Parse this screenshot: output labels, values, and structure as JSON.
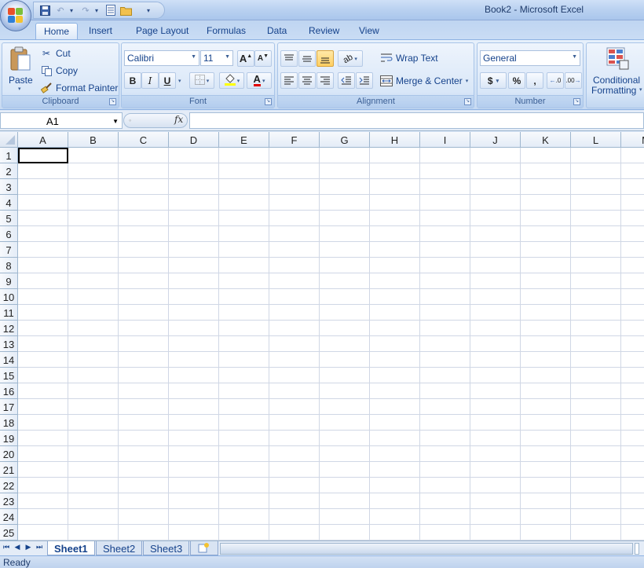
{
  "window": {
    "title": "Book2 - Microsoft Excel"
  },
  "qat": {
    "icons": [
      "save-icon",
      "undo-icon",
      "redo-icon",
      "print-preview-icon",
      "open-icon"
    ]
  },
  "tabs": [
    {
      "label": "Home",
      "active": true
    },
    {
      "label": "Insert"
    },
    {
      "label": "Page Layout"
    },
    {
      "label": "Formulas"
    },
    {
      "label": "Data"
    },
    {
      "label": "Review"
    },
    {
      "label": "View"
    }
  ],
  "ribbon": {
    "clipboard": {
      "label": "Clipboard",
      "paste": "Paste",
      "cut": "Cut",
      "copy": "Copy",
      "format_painter": "Format Painter"
    },
    "font": {
      "label": "Font",
      "name": "Calibri",
      "size": "11",
      "bold": "B",
      "italic": "I",
      "underline": "U",
      "grow": "A",
      "shrink": "A",
      "font_color": "A"
    },
    "alignment": {
      "label": "Alignment",
      "wrap_text": "Wrap Text",
      "merge_center": "Merge & Center"
    },
    "number": {
      "label": "Number",
      "format": "General",
      "currency": "$",
      "percent": "%",
      "comma": ",",
      "inc_decimal": ".0",
      "dec_decimal": ".00"
    },
    "styles": {
      "conditional_formatting_1": "Conditional",
      "conditional_formatting_2": "Formatting"
    }
  },
  "formula_bar": {
    "name_box": "A1",
    "fx": "fx",
    "value": ""
  },
  "grid": {
    "columns": [
      "A",
      "B",
      "C",
      "D",
      "E",
      "F",
      "G",
      "H",
      "I",
      "J",
      "K",
      "L",
      "M"
    ],
    "rows": [
      "1",
      "2",
      "3",
      "4",
      "5",
      "6",
      "7",
      "8",
      "9",
      "10",
      "11",
      "12",
      "13",
      "14",
      "15",
      "16",
      "17",
      "18",
      "19",
      "20",
      "21",
      "22",
      "23",
      "24",
      "25"
    ],
    "active_cell": "A1"
  },
  "sheets": [
    {
      "label": "Sheet1",
      "active": true
    },
    {
      "label": "Sheet2"
    },
    {
      "label": "Sheet3"
    }
  ],
  "status": {
    "text": "Ready"
  }
}
